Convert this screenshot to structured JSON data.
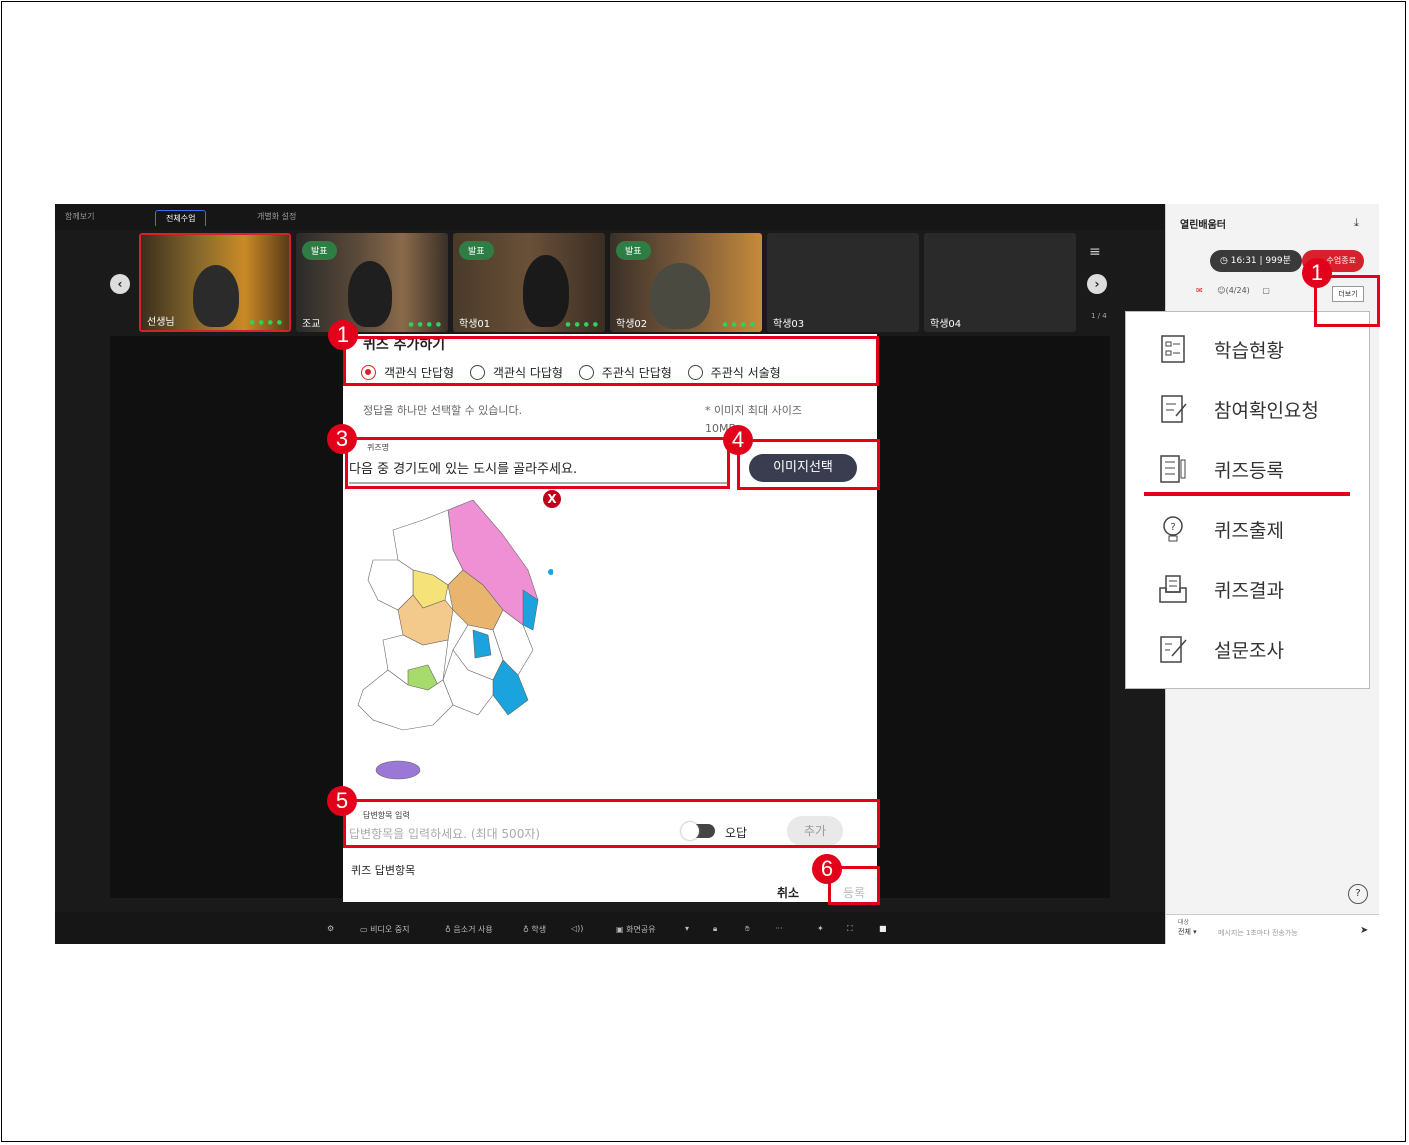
{
  "top_tabs": [
    "함께보기",
    "전체수업",
    "개별화 설정"
  ],
  "videos": [
    {
      "name": "선생님",
      "badge": ""
    },
    {
      "name": "조교",
      "badge": "발표"
    },
    {
      "name": "학생01",
      "badge": "발표"
    },
    {
      "name": "학생02",
      "badge": "발표"
    },
    {
      "name": "학생03",
      "badge": ""
    },
    {
      "name": "학생04",
      "badge": ""
    }
  ],
  "page_indicator": "1 / 4",
  "bottom_bar": {
    "video": "비디오 중지",
    "noise": "음소거 사용",
    "student": "학생",
    "share": "화면공유"
  },
  "right_panel": {
    "title": "열린배움터",
    "time": "16:31",
    "minutes": "999분",
    "end": "수업종료",
    "count": "(4/24)",
    "more": "더보기",
    "target_label": "대상",
    "target_value": "전체",
    "chat_placeholder": "메시지는 1초마다 전송가능",
    "help": "?"
  },
  "dialog": {
    "title": "퀴즈 추가하기",
    "types": [
      "객관식 단답형",
      "객관식 다답형",
      "주관식 단답형",
      "주관식 서술형"
    ],
    "help_text": "정답을 하나만 선택할 수 있습니다.",
    "image_note_1": "* 이미지 최대 사이즈",
    "image_note_2": "10MB",
    "qname_label": "퀴즈명",
    "qname_value": "다음 중 경기도에 있는 도시를 골라주세요.",
    "image_button": "이미지선택",
    "delete": "X",
    "answer_label": "답변항목 입력",
    "answer_placeholder": "답변항목을 입력하세요. (최대 500자)",
    "wrong_label": "오답",
    "add_button": "추가",
    "list_label": "퀴즈 답변항목",
    "cancel": "취소",
    "register": "등록"
  },
  "menu": [
    "학습현황",
    "참여확인요청",
    "퀴즈등록",
    "퀴즈출제",
    "퀴즈결과",
    "설문조사"
  ],
  "annotations": [
    "1",
    "1",
    "3",
    "4",
    "5",
    "6"
  ],
  "colors": {
    "accent": "#e3001b",
    "dark_button": "#3a3d4f",
    "presenting_badge": "#2e7d45"
  }
}
